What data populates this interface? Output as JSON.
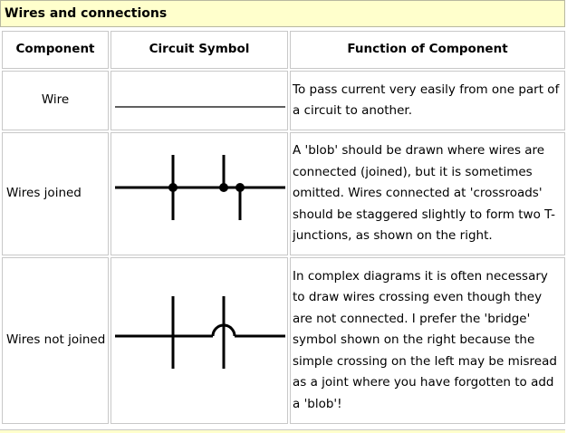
{
  "title": "Wires and connections",
  "headers": {
    "component": "Component",
    "symbol": "Circuit Symbol",
    "function": "Function of Component"
  },
  "rows": [
    {
      "component": "Wire",
      "function": "To pass current very easily from one part of a circuit to another."
    },
    {
      "component": "Wires joined",
      "function": "A 'blob' should be drawn where wires are connected (joined), but it is sometimes omitted. Wires connected at 'crossroads' should be staggered slightly to form two T-junctions, as shown on the right."
    },
    {
      "component": "Wires not joined",
      "function": "In complex diagrams it is often necessary to draw wires crossing even though they are not connected. I prefer the 'bridge' symbol shown on the right because the simple crossing on the left may be misread as a joint where you have forgotten to add a 'blob'!"
    }
  ]
}
